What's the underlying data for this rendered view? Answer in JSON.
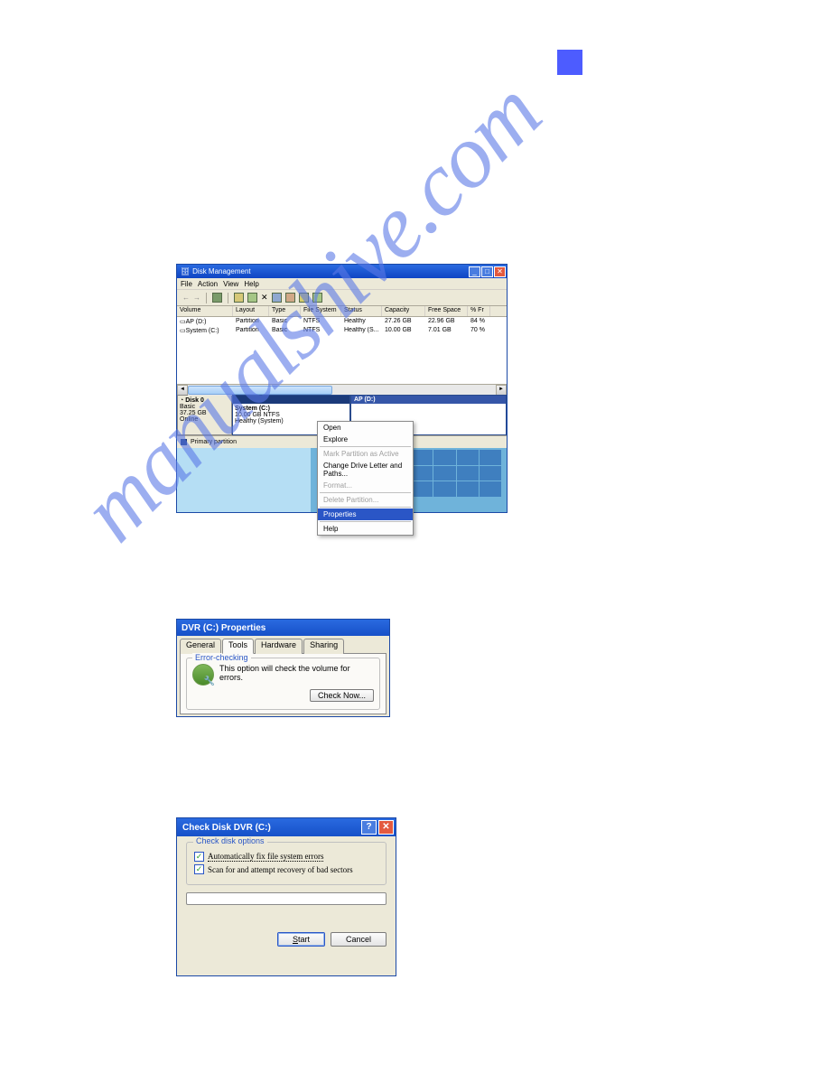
{
  "watermark": "manualshive.com",
  "disk_mgmt": {
    "title": "Disk Management",
    "menus": [
      "File",
      "Action",
      "View",
      "Help"
    ],
    "columns": [
      "Volume",
      "Layout",
      "Type",
      "File System",
      "Status",
      "Capacity",
      "Free Space",
      "% Fr"
    ],
    "rows": [
      {
        "volume": "AP (D:)",
        "layout": "Partition",
        "type": "Basic",
        "fs": "NTFS",
        "status": "Healthy",
        "capacity": "27.26 GB",
        "free": "22.96 GB",
        "pct": "84 %"
      },
      {
        "volume": "System (C:)",
        "layout": "Partition",
        "type": "Basic",
        "fs": "NTFS",
        "status": "Healthy (S...",
        "capacity": "10.00 GB",
        "free": "7.01 GB",
        "pct": "70 %"
      }
    ],
    "disk_info": {
      "name": "Disk 0",
      "type": "Basic",
      "size": "37.25 GB",
      "state": "Online"
    },
    "partitions": {
      "sysc": {
        "title": "System (C:)",
        "line1": "10.00 GB NTFS",
        "line2": "Healthy (System)"
      },
      "ap": {
        "title": "AP (D:)"
      }
    },
    "legend": "Primary partition",
    "context_menu": {
      "open": "Open",
      "explore": "Explore",
      "mark_active": "Mark Partition as Active",
      "change_letter": "Change Drive Letter and Paths...",
      "format": "Format...",
      "delete": "Delete Partition...",
      "properties": "Properties",
      "help": "Help"
    }
  },
  "props": {
    "title": "DVR (C:) Properties",
    "tabs": [
      "General",
      "Tools",
      "Hardware",
      "Sharing"
    ],
    "group_legend": "Error-checking",
    "desc": "This option will check the volume for errors.",
    "check_btn": "Check Now..."
  },
  "chkdsk": {
    "title": "Check Disk DVR (C:)",
    "group_legend": "Check disk options",
    "opt1": "Automatically fix file system errors",
    "opt2": "Scan for and attempt recovery of bad sectors",
    "start": "Start",
    "cancel": "Cancel"
  }
}
